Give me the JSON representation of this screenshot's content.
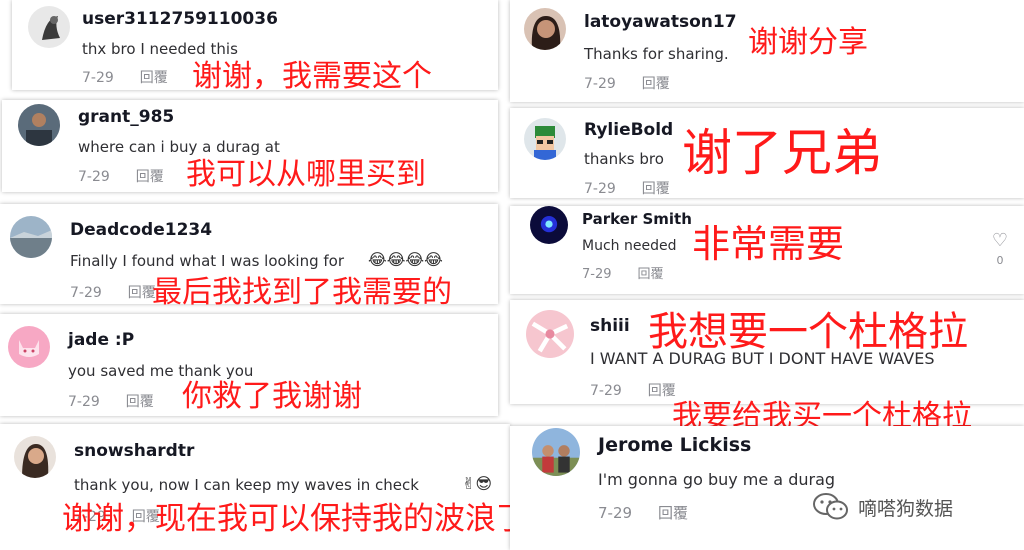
{
  "comments": [
    {
      "username": "user3112759110036",
      "text": "thx bro I needed this",
      "date": "7-29",
      "reply": "回覆",
      "translation": "谢谢，我需要这个"
    },
    {
      "username": "grant_985",
      "text": "where can i buy a durag at",
      "date": "7-29",
      "reply": "回覆",
      "translation": "我可以从哪里买到"
    },
    {
      "username": "Deadcode1234",
      "text": "Finally I found what I was looking for",
      "emoji": "😂😂😂😂",
      "date": "7-29",
      "reply": "回覆",
      "translation": "最后我找到了我需要的"
    },
    {
      "username": "jade :P",
      "text": "you saved me thank you",
      "date": "7-29",
      "reply": "回覆",
      "translation": "你救了我谢谢"
    },
    {
      "username": "snowshardtr",
      "text": "thank you, now I can keep my waves in check",
      "emoji": "✌😎",
      "date": "7-29",
      "reply": "回覆",
      "translation": "谢谢，现在我可以保持我的波浪了"
    },
    {
      "username": "latoyawatson17",
      "text": "Thanks for sharing.",
      "date": "7-29",
      "reply": "回覆",
      "translation": "谢谢分享"
    },
    {
      "username": "RylieBold",
      "text": "thanks bro",
      "date": "7-29",
      "reply": "回覆",
      "translation": "谢了兄弟"
    },
    {
      "username": "Parker Smith",
      "text": "Much needed",
      "date": "7-29",
      "reply": "回覆",
      "translation": "非常需要",
      "likes": "0"
    },
    {
      "username": "shiii",
      "text": "I WANT A DURAG BUT I DONT HAVE WAVES",
      "date": "7-29",
      "reply": "回覆",
      "translation": "我想要一个杜格拉",
      "translation2": "我要给我买一个杜格拉"
    },
    {
      "username": "Jerome Lickiss",
      "text": "I'm gonna go buy me a durag",
      "date": "7-29",
      "reply": "回覆"
    }
  ],
  "watermark": {
    "text": "嘀嗒狗数据",
    "icon": "wechat-icon"
  },
  "icons": {
    "like": "heart-outline-icon"
  },
  "colors": {
    "translation": "#ff1a1a",
    "username": "#161823",
    "meta": "#8a8b91"
  }
}
